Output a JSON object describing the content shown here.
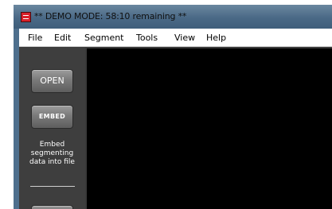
{
  "window": {
    "title": "** DEMO MODE: 58:10 remaining **",
    "icon": "app-icon"
  },
  "menubar": {
    "items": [
      "File",
      "Edit",
      "Segment",
      "Tools",
      "View",
      "Help"
    ]
  },
  "sidebar": {
    "open_label": "OPEN",
    "embed_label": "EMBED",
    "embed_description": "Embed\nsegmenting\ndata into file"
  }
}
